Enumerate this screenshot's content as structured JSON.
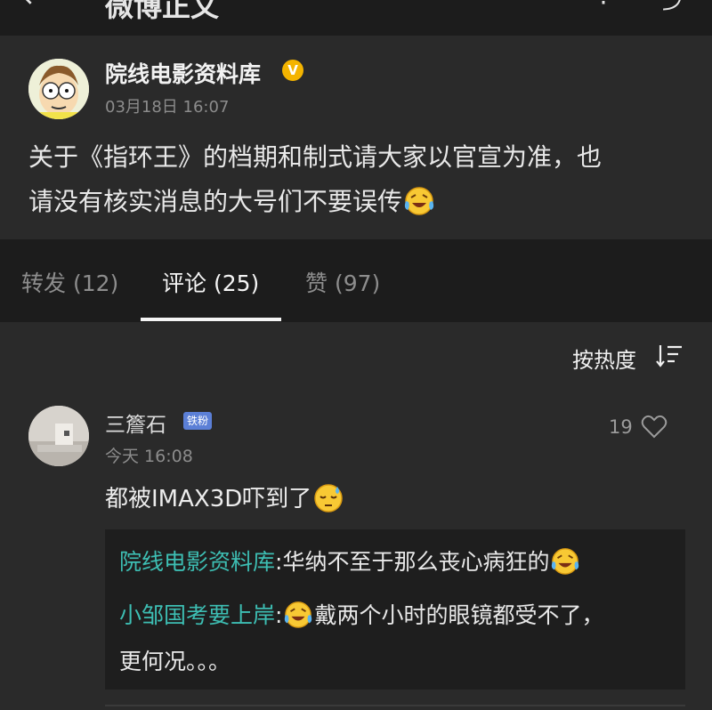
{
  "topbar": {
    "back_icon": "back-arrow-icon",
    "title": "微博正文",
    "more_icon": "more-icon",
    "share_icon": "share-icon"
  },
  "post": {
    "author": "院线电影资料库",
    "verified_badge": "V",
    "time": "03月18日 16:07",
    "text_line1": "关于《指环王》的档期和制式请大家以官宣为准，也",
    "text_line2": "请没有核实消息的大号们不要误传"
  },
  "tabs": [
    {
      "label": "转发 (12)",
      "active": false
    },
    {
      "label": "评论 (25)",
      "active": true
    },
    {
      "label": "赞 (97)",
      "active": false
    }
  ],
  "sort": {
    "label": "按热度",
    "icon": "sort-icon"
  },
  "comment": {
    "name": "三簷石",
    "badge": "铁粉",
    "time": "今天 16:08",
    "likes": "19",
    "text": "都被IMAX3D吓到了",
    "replies": [
      {
        "name": "院线电影资料库",
        "sep": ":",
        "text": "华纳不至于那么丧心病狂的"
      },
      {
        "name": "小邹国考要上岸",
        "sep": ":",
        "text_after_emoji": "戴两个小时的眼镜都受不了，",
        "text_line2": "更何况。。。"
      }
    ]
  },
  "colors": {
    "accent_link": "#3dbeb3",
    "verified": "#f4b400",
    "badge": "#5b7fd6",
    "bg_dark": "#1c1c1c",
    "bg_card": "#2a2a2a"
  }
}
